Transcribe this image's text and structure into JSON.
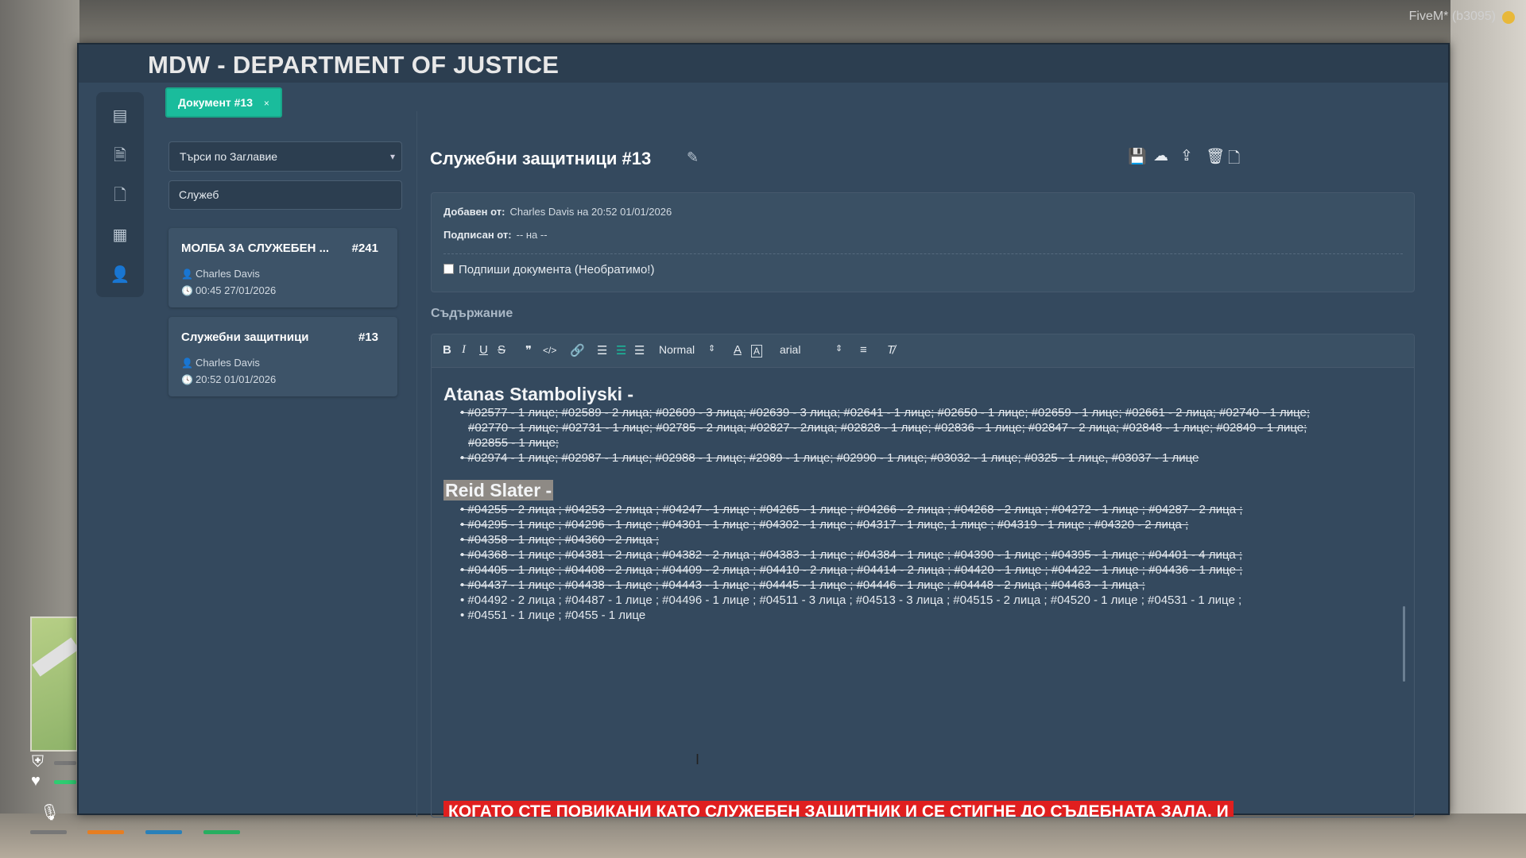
{
  "overlay": {
    "client_label": "FiveM* (b3095)"
  },
  "app": {
    "title": "MDW - DEPARTMENT OF JUSTICE"
  },
  "rail_icons": [
    "newspaper-icon",
    "document-icon",
    "file-icon",
    "clipboard-icon",
    "user-icon"
  ],
  "tab": {
    "label": "Документ #13",
    "close": "×"
  },
  "search": {
    "select_value": "Търси по Заглавие",
    "input_value": "Служеб"
  },
  "documents": [
    {
      "title": "МОЛБА ЗА СЛУЖЕБЕН ...",
      "number": "#241",
      "author": "Charles Davis",
      "time": "00:45 27/01/2026"
    },
    {
      "title": "Служебни защитници",
      "number": "#13",
      "author": "Charles Davis",
      "time": "20:52 01/01/2026"
    }
  ],
  "document": {
    "title": "Служебни защитници #13",
    "added_by_label": "Добавен от:",
    "added_by_value": "Charles Davis на 20:52 01/01/2026",
    "signed_by_label": "Подписан от:",
    "signed_by_value": "-- на --",
    "sign_checkbox_label": "Подпиши документа (Необратимо!)"
  },
  "content_section_label": "Съдържание",
  "editor_toolbar": {
    "header_select": "Normal",
    "font_select": "arial"
  },
  "editor_content": {
    "heading1": "Atanas Stamboliyski -",
    "list1": [
      "• #02577 - 1 лице; #02589 - 2 лица; #02609 - 3 лица; #02639 - 3 лица; #02641 - 1 лице; #02650 - 1 лице; #02659 - 1 лице; #02661 - 2 лица; #02740 - 1 лице;",
      "#02770 - 1 лице; #02731 - 1 лице; #02785 - 2 лица; #02827 - 2лица; #02828 - 1 лице; #02836 - 1 лице; #02847 - 2 лица; #02848 - 1 лице; #02849 - 1 лице;",
      "#02855 - 1 лице;",
      "• #02974 - 1 лице; #02987 - 1 лице; #02988 - 1 лице; #2989 - 1 лице; #02990 - 1 лице; #03032 - 1 лице; #0325 - 1 лице, #03037 - 1 лице"
    ],
    "heading2": "Reid Slater -",
    "list2": [
      "• #04255 - 2 лица ; #04253 - 2 лица ; #04247 - 1 лице ; #04265 - 1 лице ; #04266 - 2 лица ; #04268 - 2 лица ; #04272 - 1 лице ; #04287 - 2 лица ;",
      "• #04295 - 1 лице ; #04296 - 1 лице ; #04301 - 1 лице ; #04302 - 1 лице ;  #04317 - 1 лице, 1 лице  ; #04319 - 1 лице ; #04320 - 2 лица ;",
      "• #04358 - 1 лице ; #04360 - 2 лица ;",
      "• #04368 - 1 лице ; #04381 - 2 лица ; #04382 - 2 лица ; #04383 - 1 лице ; #04384 - 1 лице ; #04390 - 1 лице ;  #04395 - 1 лице ; #04401 - 4 лица ;",
      "• #04405 - 1 лице ; #04408 - 2 лица ; #04409 - 2 лица ; #04410 - 2 лица ;  #04414 - 2 лица ; #04420 - 1 лице ; #04422 - 1 лице ; #04436 - 1 лице ;",
      "• #04437 - 1 лице  ; #04438 - 1 лице ; #04443 - 1 лице ; #04445 - 1 лице ; #04446 - 1 лице ; #04448 - 2 лица ; #04463 - 1 лица ;",
      "• #04492 - 2 лица ; #04487 - 1 лице ; #04496 - 1 лице ; #04511 - 3 лица ; #04513 - 3 лица ; #04515 - 2 лица ; #04520 - 1 лице ; #04531 - 1 лице ;",
      "• #04551 - 1 лице ; #0455 - 1 лице"
    ],
    "banner": "КОГАТО СТЕ ПОВИКАНИ КАТО СЛУЖЕБЕН ЗАЩИТНИК И СЕ СТИГНЕ ДО СЪДЕБНАТА ЗАЛА, И"
  },
  "colors": {
    "window_bg": "#34495e",
    "panel_dark": "#2c3e50",
    "accent_tab": "#1abc9c",
    "banner_red": "#e01f1f"
  }
}
